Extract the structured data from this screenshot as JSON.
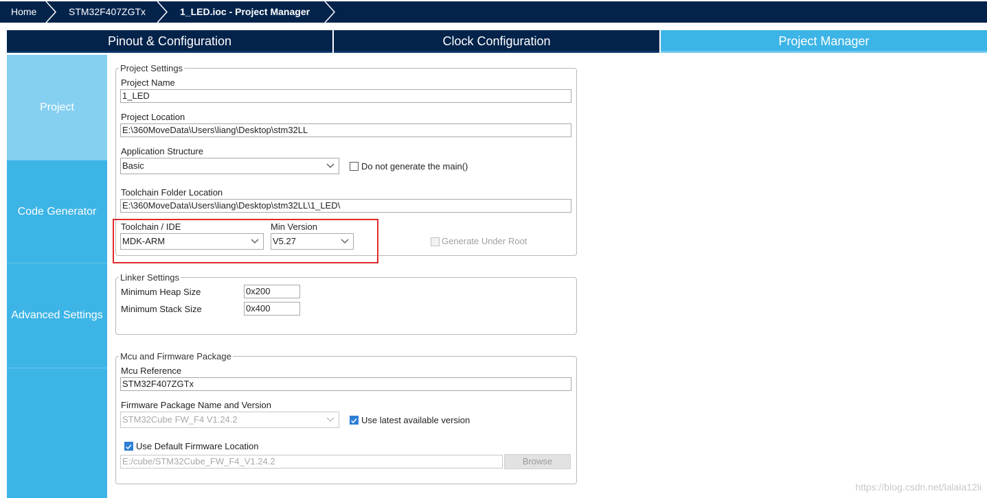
{
  "breadcrumb": {
    "items": [
      {
        "label": "Home"
      },
      {
        "label": "STM32F407ZGTx"
      },
      {
        "label": "1_LED.ioc - Project Manager"
      }
    ]
  },
  "tabs": [
    {
      "label": "Pinout & Configuration"
    },
    {
      "label": "Clock Configuration"
    },
    {
      "label": "Project Manager"
    }
  ],
  "sidebar": {
    "items": [
      {
        "label": "Project"
      },
      {
        "label": "Code Generator"
      },
      {
        "label": "Advanced Settings"
      }
    ]
  },
  "project_settings": {
    "legend": "Project Settings",
    "name_label": "Project Name",
    "name_value": "1_LED",
    "location_label": "Project Location",
    "location_value": "E:\\360MoveData\\Users\\liang\\Desktop\\stm32LL",
    "app_structure_label": "Application Structure",
    "app_structure_value": "Basic",
    "no_main_label": "Do not generate the main()",
    "toolchain_folder_label": "Toolchain Folder Location",
    "toolchain_folder_value": "E:\\360MoveData\\Users\\liang\\Desktop\\stm32LL\\1_LED\\",
    "toolchain_label": "Toolchain / IDE",
    "toolchain_value": "MDK-ARM",
    "min_version_label": "Min Version",
    "min_version_value": "V5.27",
    "generate_under_root_label": "Generate Under Root"
  },
  "linker_settings": {
    "legend": "Linker Settings",
    "heap_label": "Minimum Heap Size",
    "heap_value": "0x200",
    "stack_label": "Minimum Stack Size",
    "stack_value": "0x400"
  },
  "mcu_package": {
    "legend": "Mcu and Firmware Package",
    "mcu_ref_label": "Mcu Reference",
    "mcu_ref_value": "STM32F407ZGTx",
    "fw_label": "Firmware Package Name and Version",
    "fw_value": "STM32Cube FW_F4 V1.24.2",
    "use_latest_label": "Use latest available version",
    "use_default_loc_label": "Use Default Firmware Location",
    "fw_location_value": "E:/cube/STM32Cube_FW_F4_V1.24.2",
    "browse_label": "Browse"
  },
  "watermark": "https://blog.csdn.net/lalala12li",
  "colors": {
    "navy": "#03234b",
    "accent": "#3cb4e6",
    "sidebar_active": "#85cff0",
    "highlight": "#e0292b"
  }
}
